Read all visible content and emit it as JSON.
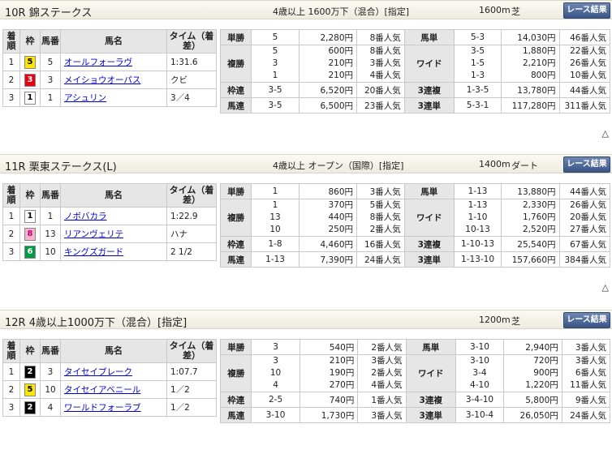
{
  "buttons": {
    "race_result": "レース結果"
  },
  "headers": {
    "rank": "着順",
    "waku": "枠",
    "num": "馬番",
    "name": "馬名",
    "time": "タイム（着差）"
  },
  "labels": {
    "tansho": "単勝",
    "fukusho": "複勝",
    "wakuren": "枠連",
    "umaren": "馬連",
    "umatan": "馬単",
    "wide": "ワイド",
    "sanrenpuku": "3連複",
    "sanrentan": "3連単"
  },
  "up_icon": "△",
  "colors": {
    "w1": "#ffffff",
    "w2": "#000000",
    "w3": "#e60012",
    "w5": "#ffe600",
    "w6": "#009a44",
    "w8": "#f8b4c8"
  },
  "races": [
    {
      "title": "10R 錦ステークス",
      "cond": "4歳以上 1600万下（混合）[指定]",
      "dist": "1600m",
      "surface": "芝",
      "rows": [
        {
          "rank": "1",
          "waku": "5",
          "num": "5",
          "name": "オールフォーラヴ",
          "time": "1:31.6"
        },
        {
          "rank": "2",
          "waku": "3",
          "num": "3",
          "name": "メイショウオーパス",
          "time": "クビ"
        },
        {
          "rank": "3",
          "waku": "1",
          "num": "1",
          "name": "アシュリン",
          "time": "3／4"
        }
      ],
      "tansho": {
        "n": "5",
        "amt": "2,280円",
        "pop": "8番人気"
      },
      "fukusho": [
        {
          "n": "5",
          "amt": "600円",
          "pop": "8番人気"
        },
        {
          "n": "3",
          "amt": "210円",
          "pop": "3番人気"
        },
        {
          "n": "1",
          "amt": "210円",
          "pop": "4番人気"
        }
      ],
      "wakuren": {
        "n": "3-5",
        "amt": "6,520円",
        "pop": "20番人気"
      },
      "umaren": {
        "n": "3-5",
        "amt": "6,500円",
        "pop": "23番人気"
      },
      "umatan": {
        "n": "5-3",
        "amt": "14,030円",
        "pop": "46番人気"
      },
      "wide": [
        {
          "n": "3-5",
          "amt": "1,880円",
          "pop": "22番人気"
        },
        {
          "n": "1-5",
          "amt": "2,210円",
          "pop": "26番人気"
        },
        {
          "n": "1-3",
          "amt": "800円",
          "pop": "10番人気"
        }
      ],
      "sanrenpuku": {
        "n": "1-3-5",
        "amt": "13,780円",
        "pop": "44番人気"
      },
      "sanrentan": {
        "n": "5-3-1",
        "amt": "117,280円",
        "pop": "311番人気"
      }
    },
    {
      "title": "11R 栗東ステークス(L)",
      "cond": "4歳以上 オープン（国際）[指定]",
      "dist": "1400m",
      "surface": "ダート",
      "rows": [
        {
          "rank": "1",
          "waku": "1",
          "num": "1",
          "name": "ノボバカラ",
          "time": "1:22.9"
        },
        {
          "rank": "2",
          "waku": "8",
          "num": "13",
          "name": "リアンヴェリテ",
          "time": "ハナ"
        },
        {
          "rank": "3",
          "waku": "6",
          "num": "10",
          "name": "キングズガード",
          "time": "2 1/2"
        }
      ],
      "tansho": {
        "n": "1",
        "amt": "860円",
        "pop": "3番人気"
      },
      "fukusho": [
        {
          "n": "1",
          "amt": "370円",
          "pop": "5番人気"
        },
        {
          "n": "13",
          "amt": "440円",
          "pop": "8番人気"
        },
        {
          "n": "10",
          "amt": "250円",
          "pop": "2番人気"
        }
      ],
      "wakuren": {
        "n": "1-8",
        "amt": "4,460円",
        "pop": "16番人気"
      },
      "umaren": {
        "n": "1-13",
        "amt": "7,390円",
        "pop": "24番人気"
      },
      "umatan": {
        "n": "1-13",
        "amt": "13,880円",
        "pop": "44番人気"
      },
      "wide": [
        {
          "n": "1-13",
          "amt": "2,330円",
          "pop": "26番人気"
        },
        {
          "n": "1-10",
          "amt": "1,760円",
          "pop": "20番人気"
        },
        {
          "n": "10-13",
          "amt": "2,520円",
          "pop": "27番人気"
        }
      ],
      "sanrenpuku": {
        "n": "1-10-13",
        "amt": "25,540円",
        "pop": "67番人気"
      },
      "sanrentan": {
        "n": "1-13-10",
        "amt": "157,660円",
        "pop": "384番人気"
      }
    },
    {
      "title": "12R 4歳以上1000万下（混合）[指定]",
      "cond": "",
      "dist": "1200m",
      "surface": "芝",
      "rows": [
        {
          "rank": "1",
          "waku": "2",
          "num": "3",
          "name": "タイセイブレーク",
          "time": "1:07.7"
        },
        {
          "rank": "2",
          "waku": "5",
          "num": "10",
          "name": "タイセイアベニール",
          "time": "1／2"
        },
        {
          "rank": "3",
          "waku": "2",
          "num": "4",
          "name": "ワールドフォーラブ",
          "time": "1／2"
        }
      ],
      "tansho": {
        "n": "3",
        "amt": "540円",
        "pop": "2番人気"
      },
      "fukusho": [
        {
          "n": "3",
          "amt": "210円",
          "pop": "3番人気"
        },
        {
          "n": "10",
          "amt": "190円",
          "pop": "2番人気"
        },
        {
          "n": "4",
          "amt": "270円",
          "pop": "4番人気"
        }
      ],
      "wakuren": {
        "n": "2-5",
        "amt": "740円",
        "pop": "1番人気"
      },
      "umaren": {
        "n": "3-10",
        "amt": "1,730円",
        "pop": "3番人気"
      },
      "umatan": {
        "n": "3-10",
        "amt": "2,940円",
        "pop": "3番人気"
      },
      "wide": [
        {
          "n": "3-10",
          "amt": "720円",
          "pop": "3番人気"
        },
        {
          "n": "3-4",
          "amt": "900円",
          "pop": "6番人気"
        },
        {
          "n": "4-10",
          "amt": "1,220円",
          "pop": "11番人気"
        }
      ],
      "sanrenpuku": {
        "n": "3-4-10",
        "amt": "5,800円",
        "pop": "9番人気"
      },
      "sanrentan": {
        "n": "3-10-4",
        "amt": "26,050円",
        "pop": "24番人気"
      }
    }
  ]
}
